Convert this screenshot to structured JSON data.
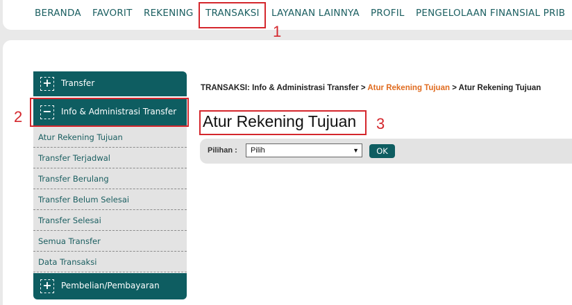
{
  "topnav": {
    "items": [
      "BERANDA",
      "FAVORIT",
      "REKENING",
      "TRANSAKSI",
      "LAYANAN LAINNYA",
      "PROFIL",
      "PENGELOLAAN FINANSIAL PRIB"
    ]
  },
  "sidebar": {
    "sections": [
      {
        "label": "Transfer",
        "icon": "plus-icon",
        "symbol": "+"
      },
      {
        "label": "Info & Administrasi Transfer",
        "icon": "minus-icon",
        "symbol": "−"
      },
      {
        "label": "Pembelian/Pembayaran",
        "icon": "plus-icon",
        "symbol": "+"
      }
    ],
    "items": [
      "Atur Rekening Tujuan",
      "Transfer Terjadwal",
      "Transfer Berulang",
      "Transfer Belum Selesai",
      "Transfer Selesai",
      "Semua Transfer",
      "Data Transaksi"
    ]
  },
  "breadcrumb": {
    "part1": "TRANSAKSI: Info & Administrasi Transfer > ",
    "part2": "Atur Rekening Tujuan",
    "part3": " > Atur Rekening Tujuan"
  },
  "page": {
    "title": "Atur Rekening Tujuan"
  },
  "filter": {
    "label": "Pilihan :",
    "selected": "Pilih",
    "button": "OK"
  },
  "annotations": [
    "1",
    "2",
    "3"
  ],
  "colors": {
    "accent": "#0e5d61",
    "highlight": "#d4262c",
    "breadcrumb_link": "#e06b1f"
  }
}
